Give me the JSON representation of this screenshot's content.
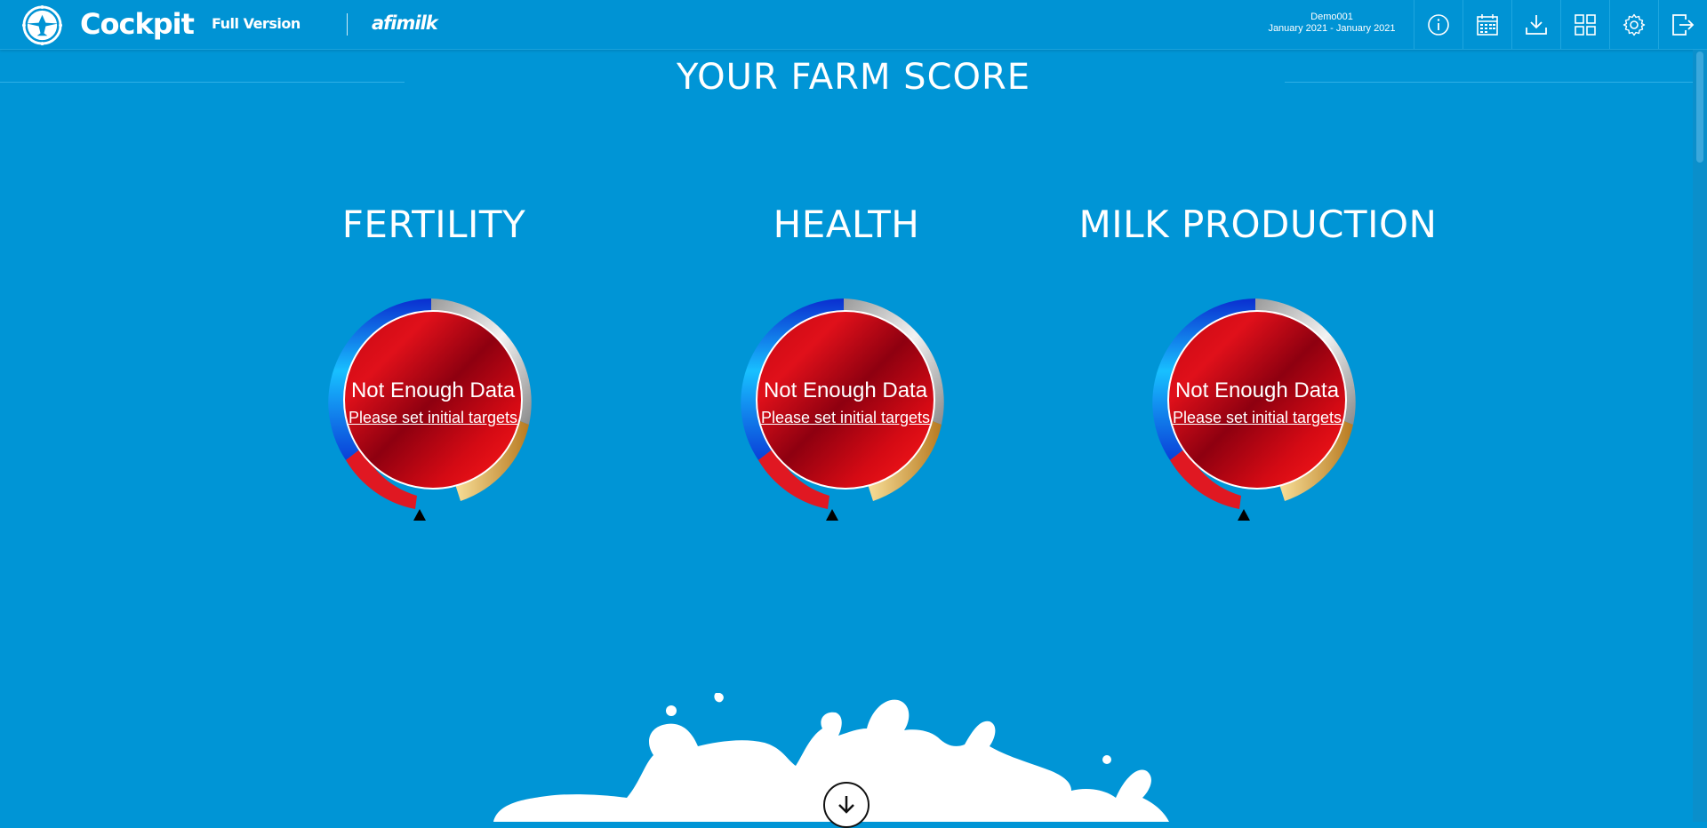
{
  "header": {
    "app_title": "Cockpit",
    "version_label": "Full Version",
    "brand": "afimilk",
    "farm_name": "Demo001",
    "date_range": "January 2021 - January 2021",
    "icons": [
      "info-icon",
      "calendar-icon",
      "download-icon",
      "grid-icon",
      "gear-icon",
      "logout-icon"
    ]
  },
  "main": {
    "section_title": "YOUR FARM SCORE",
    "cards": [
      {
        "title": "FERTILITY",
        "status": "Not Enough Data",
        "action": "Please set initial targets"
      },
      {
        "title": "HEALTH",
        "status": "Not Enough Data",
        "action": "Please set initial targets"
      },
      {
        "title": "MILK PRODUCTION",
        "status": "Not Enough Data",
        "action": "Please set initial targets"
      }
    ]
  },
  "colors": {
    "background": "#0095d6",
    "gauge_red": "#d40a14",
    "ring_blue": "#0a3fd8",
    "ring_gold": "#c9902f",
    "ring_silver": "#c8c8c8"
  }
}
